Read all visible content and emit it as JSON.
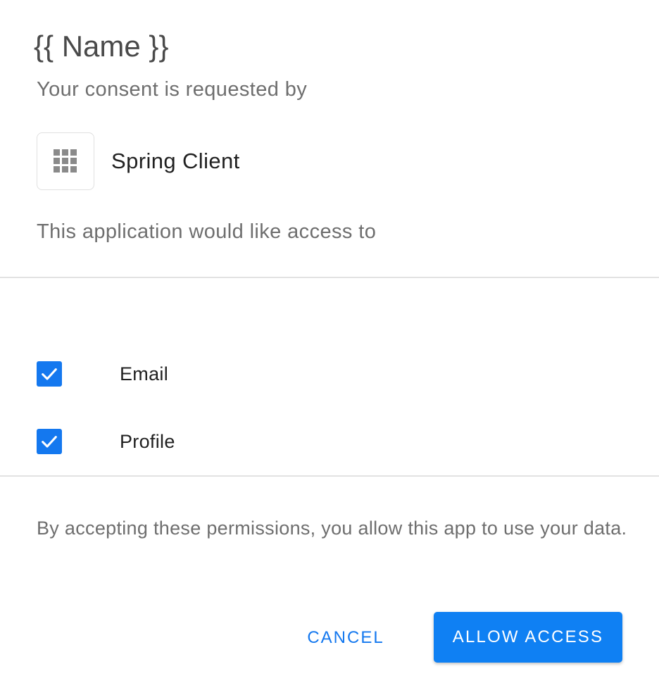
{
  "header": {
    "title": "{{ Name }}",
    "subtitle": "Your consent is requested by"
  },
  "client": {
    "icon": "apps-grid-icon",
    "name": "Spring Client"
  },
  "access_text": "This application would like access to",
  "scopes": [
    {
      "label": "Email",
      "checked": true
    },
    {
      "label": "Profile",
      "checked": true
    }
  ],
  "notice": "By accepting these permissions, you allow this app to use your data.",
  "actions": {
    "cancel_label": "CANCEL",
    "allow_label": "ALLOW ACCESS"
  },
  "colors": {
    "accent": "#1478ef",
    "checkbox": "#1478ef",
    "primary_button": "#0f80f3"
  }
}
